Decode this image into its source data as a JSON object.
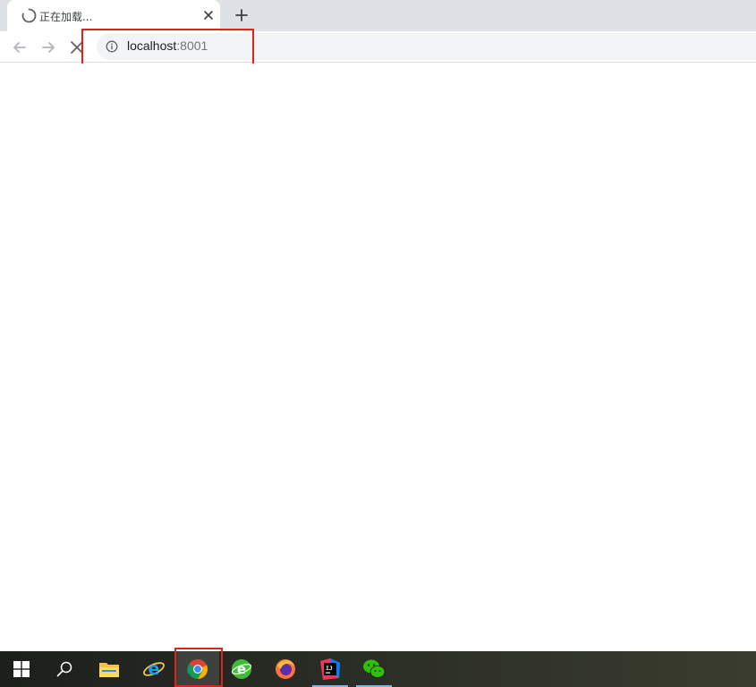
{
  "tab": {
    "title": "正在加载...",
    "close_icon": "close-icon",
    "loading_icon": "loading-spinner-icon"
  },
  "new_tab_icon": "plus-icon",
  "nav": {
    "back_icon": "arrow-left-icon",
    "forward_icon": "arrow-right-icon",
    "stop_icon": "close-icon"
  },
  "address_bar": {
    "host": "localhost",
    "port": ":8001",
    "security_icon": "info-icon"
  },
  "colors": {
    "tabstrip_bg": "#dee1e6",
    "omnibox_bg": "#f1f3f4",
    "highlight_red": "#e0221b",
    "taskbar_accent": "#76b9ed"
  },
  "taskbar": {
    "items": [
      {
        "name": "start",
        "icon": "windows-logo-icon"
      },
      {
        "name": "search",
        "icon": "search-icon"
      },
      {
        "name": "file-explorer",
        "icon": "folder-icon"
      },
      {
        "name": "internet-explorer",
        "icon": "internet-explorer-icon"
      },
      {
        "name": "chrome",
        "icon": "chrome-icon",
        "active": true
      },
      {
        "name": "360-browser",
        "icon": "green-browser-icon"
      },
      {
        "name": "firefox",
        "icon": "firefox-icon"
      },
      {
        "name": "intellij-idea",
        "icon": "intellij-icon",
        "running": true
      },
      {
        "name": "wechat",
        "icon": "wechat-icon",
        "running": true
      }
    ]
  }
}
